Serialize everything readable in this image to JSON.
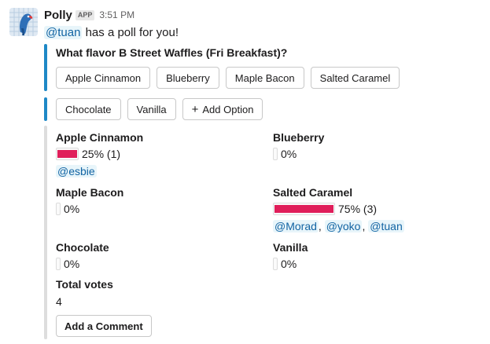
{
  "message": {
    "sender": "Polly",
    "badge": "APP",
    "time": "3:51 PM",
    "mention": "@tuan",
    "intro_text": " has a poll for you!"
  },
  "poll": {
    "question": "What flavor B Street Waffles (Fri Breakfast)?",
    "buttons_row1": [
      "Apple Cinnamon",
      "Blueberry",
      "Maple Bacon",
      "Salted Caramel"
    ],
    "buttons_row2": [
      "Chocolate",
      "Vanilla"
    ],
    "add_option": "Add Option",
    "add_option_icon": "plus-icon",
    "results": [
      {
        "name": "Apple Cinnamon",
        "percent_text": "25% (1)",
        "fraction": 0.25,
        "voters": [
          "@esbie"
        ]
      },
      {
        "name": "Blueberry",
        "percent_text": "0%",
        "fraction": 0,
        "voters": []
      },
      {
        "name": "Maple Bacon",
        "percent_text": "0%",
        "fraction": 0,
        "voters": []
      },
      {
        "name": "Salted Caramel",
        "percent_text": "75% (3)",
        "fraction": 0.75,
        "voters": [
          "@Morad",
          "@yoko",
          "@tuan"
        ]
      },
      {
        "name": "Chocolate",
        "percent_text": "0%",
        "fraction": 0,
        "voters": []
      },
      {
        "name": "Vanilla",
        "percent_text": "0%",
        "fraction": 0,
        "voters": []
      }
    ],
    "total_label": "Total votes",
    "total_value": "4",
    "comment_button": "Add a Comment"
  },
  "colors": {
    "accent_bar": "#1e88c6",
    "vote_fill": "#e01e5a",
    "mention_text": "#1264a3"
  }
}
